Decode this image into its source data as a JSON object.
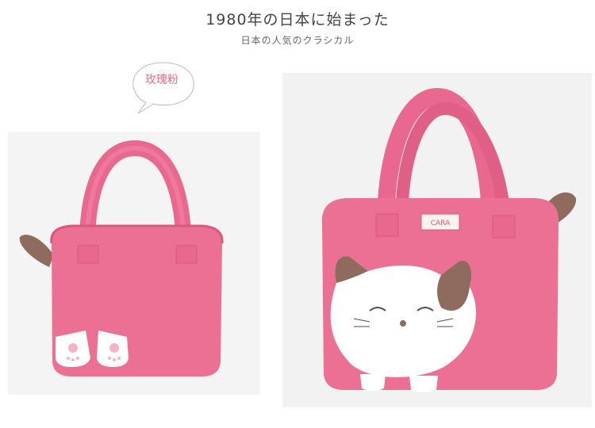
{
  "heading": {
    "title": "1980年の日本に始まった",
    "subtitle": "日本の人気のクラシカル"
  },
  "color_tag": {
    "label": "玫瑰粉",
    "color": "#e96a90"
  },
  "label_tag": {
    "text": "CARA"
  },
  "colors": {
    "bag_pink": "#ec6f94",
    "bag_pink_dark": "#d9587e",
    "cat_brown": "#8e6b5c",
    "cat_white": "#ffffff",
    "background": "#f3f3f3"
  }
}
